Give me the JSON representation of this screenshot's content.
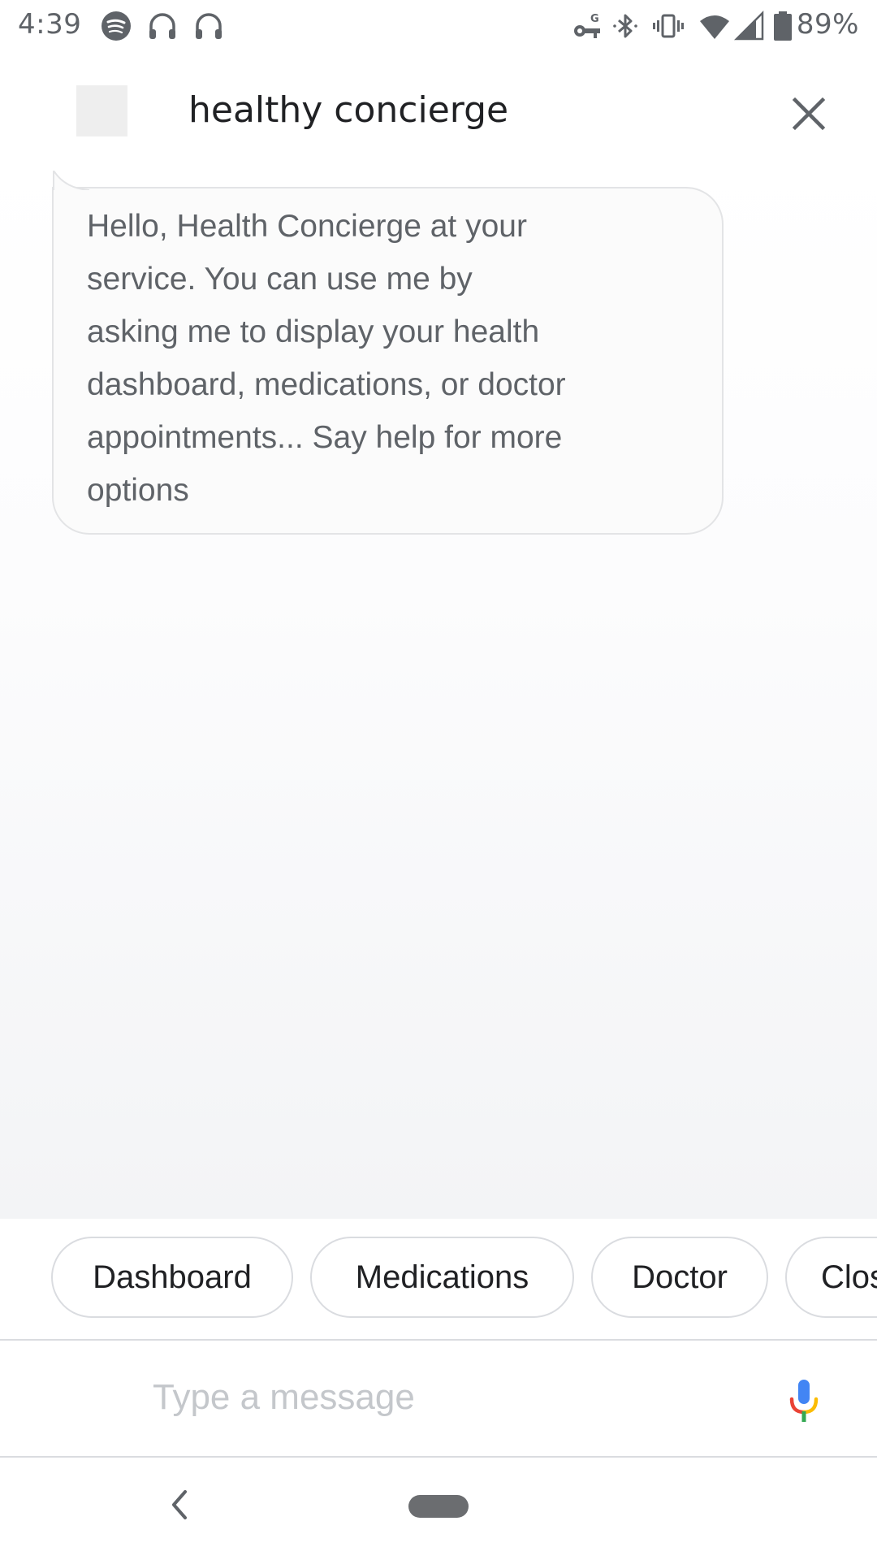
{
  "status_bar": {
    "time": "4:39",
    "battery_percent": "89%",
    "icons": [
      "spotify-icon",
      "headphones-icon",
      "headphones-icon",
      "vpn-key-icon",
      "bluetooth-icon",
      "vibrate-icon",
      "wifi-icon",
      "cell-signal-icon",
      "battery-icon"
    ],
    "battery_level": 0.89
  },
  "header": {
    "title": "healthy concierge",
    "close_icon": "close-icon"
  },
  "conversation": {
    "messages": [
      {
        "sender": "agent",
        "text": "Hello, Health Concierge at your\nservice. You can use me by\nasking me to display your health\ndashboard, medications, or doctor\nappointments... Say help for more\noptions"
      }
    ]
  },
  "suggestions": [
    "Dashboard",
    "Medications",
    "Doctor",
    "Clos"
  ],
  "composer": {
    "placeholder": "Type a message",
    "mic_icon": "mic-icon"
  },
  "nav": {
    "back_icon": "back-icon",
    "home_icon": "home-pill-icon"
  },
  "colors": {
    "text_primary": "#202124",
    "text_secondary": "#5f6368",
    "chip_border": "#dadce0",
    "mic_blue": "#4285f4",
    "mic_red": "#ea4335",
    "mic_yellow": "#fbbc04",
    "mic_green": "#34a853"
  }
}
